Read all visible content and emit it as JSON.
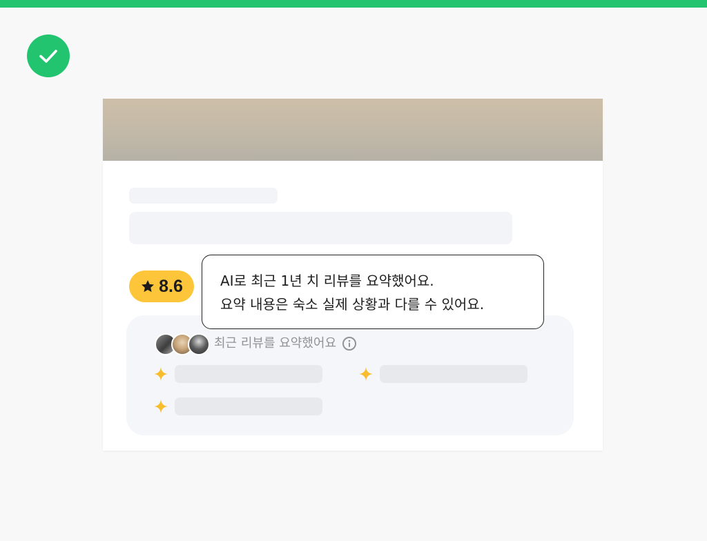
{
  "colors": {
    "accent_green": "#22c46f",
    "rating_yellow": "#fdc63a",
    "skeleton": "#f3f4f7",
    "summary_bg": "#f5f6f9"
  },
  "status": {
    "icon": "check-icon"
  },
  "rating": {
    "icon": "star-icon",
    "score": "8.6"
  },
  "summary": {
    "title": "최근 리뷰를 요약했어요",
    "info_icon": "info-icon",
    "item_icon": "sparkle-icon"
  },
  "tooltip": {
    "line1": "AI로 최근 1년 치 리뷰를 요약했어요.",
    "line2": "요약 내용은 숙소 실제 상황과 다를 수 있어요."
  }
}
